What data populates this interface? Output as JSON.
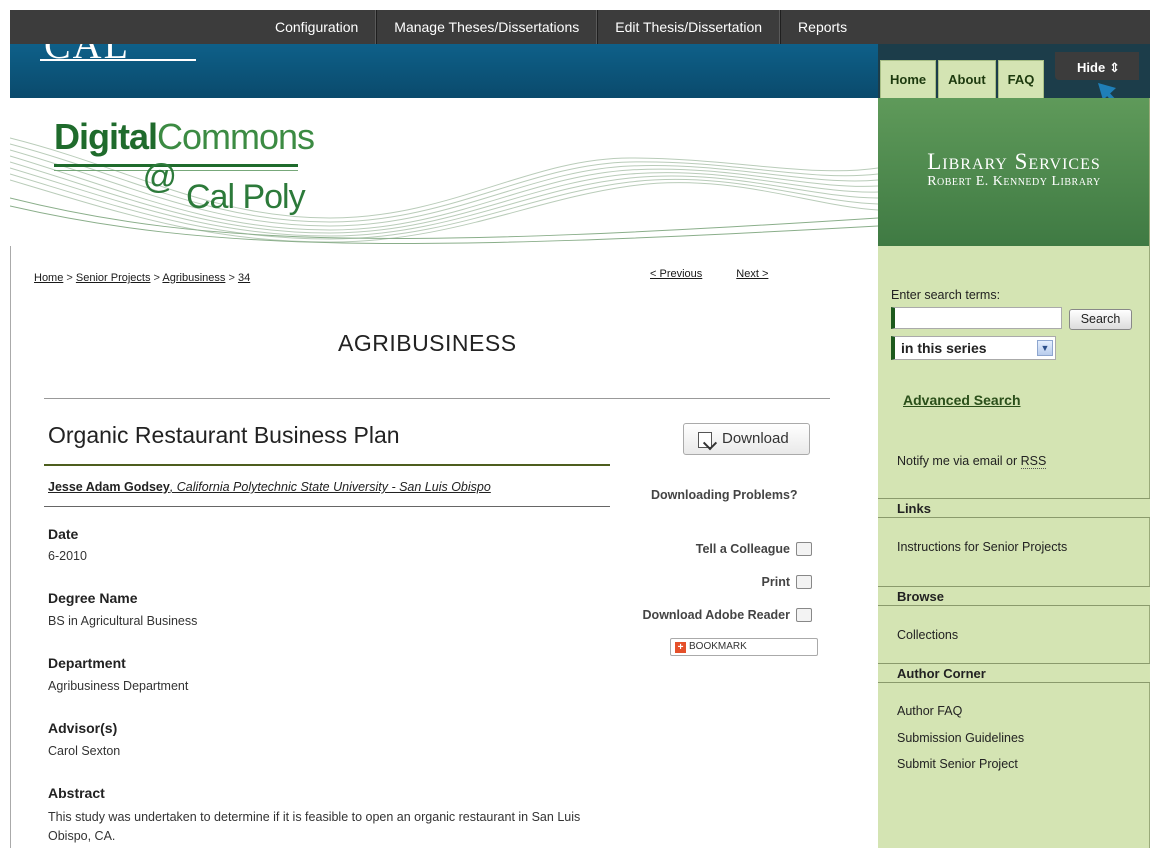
{
  "admin_menu": {
    "items": [
      "Configuration",
      "Manage Theses/Dissertations",
      "Edit Thesis/Dissertation",
      "Reports"
    ],
    "hide_label": "Hide",
    "hide_arrow": "⇕"
  },
  "header": {
    "institution_logo": "CAL POLY",
    "site_logo_digital": "Digital",
    "site_logo_commons": "Commons",
    "site_logo_at": "@",
    "site_logo_calpoly": "Cal Poly",
    "library_line1": "Library Services",
    "library_line2": "Robert E. Kennedy Library",
    "tabs": [
      "Home",
      "About",
      "FAQ"
    ]
  },
  "breadcrumb": {
    "home": "Home",
    "sep": " > ",
    "senior_projects": "Senior Projects",
    "agribusiness": "Agribusiness",
    "number": "34"
  },
  "pager": {
    "previous": "< Previous",
    "next": "Next >"
  },
  "series_title": "AGRIBUSINESS",
  "article": {
    "title": "Organic Restaurant Business Plan",
    "author_name": "Jesse Adam Godsey",
    "author_affiliation": ", California Polytechnic State University - San Luis Obispo",
    "fields": [
      {
        "label": "Date",
        "value": "6-2010"
      },
      {
        "label": "Degree Name",
        "value": "BS in Agricultural Business"
      },
      {
        "label": "Department",
        "value": "Agribusiness Department"
      },
      {
        "label": "Advisor(s)",
        "value": "Carol Sexton"
      }
    ],
    "abstract_label": "Abstract",
    "abstract_text": "This study was undertaken to determine if it is feasible to open an organic restaurant in San Luis Obispo, CA."
  },
  "actions": {
    "download": "Download",
    "downloading_problems": "Downloading Problems?",
    "tell_colleague": "Tell a Colleague",
    "print": "Print",
    "adobe_reader": "Download Adobe Reader",
    "bookmark": "BOOKMARK"
  },
  "sidebar": {
    "search_label": "Enter search terms:",
    "search_value": "",
    "search_button": "Search",
    "scope": "in this series",
    "advanced_search": "Advanced Search",
    "notify_text": "Notify me via email or ",
    "notify_rss": "RSS",
    "sections": [
      {
        "title": "Links",
        "items": [
          "Instructions for Senior Projects"
        ]
      },
      {
        "title": "Browse",
        "items": [
          "Collections"
        ]
      },
      {
        "title": "Author Corner",
        "items": [
          "Author FAQ",
          "Submission Guidelines",
          "Submit Senior Project"
        ]
      }
    ]
  },
  "colors": {
    "admin_bar": "#3c3c3c",
    "header_blue": "#0e6089",
    "sidebar_green": "#d4e4b3",
    "banner_green": "#4f8a4f",
    "accent_dark_green": "#1d5a1d"
  },
  "icons": [
    "download-icon",
    "email-icon",
    "print-icon",
    "pdf-icon",
    "addthis-icon",
    "pointer-arrow-icon"
  ]
}
